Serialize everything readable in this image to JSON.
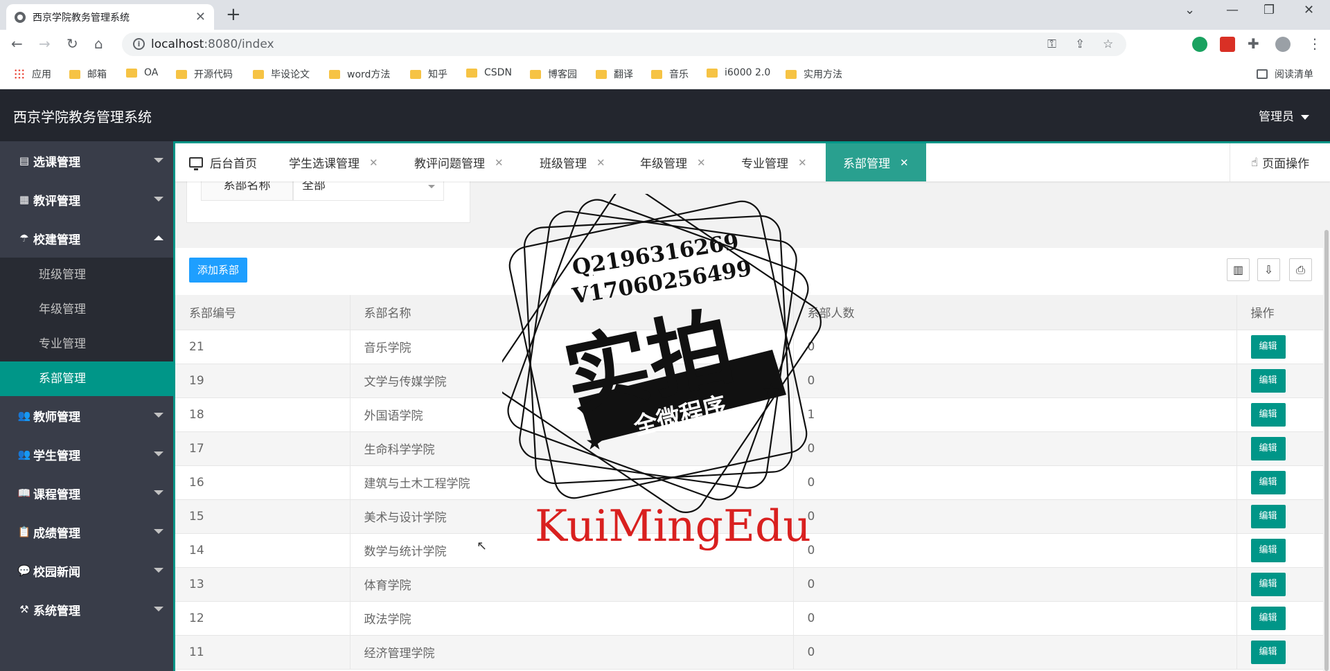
{
  "browser": {
    "tab_title": "西京学院教务管理系统",
    "url_host": "localhost",
    "url_rest": ":8080/index",
    "bookmarks": [
      "应用",
      "邮箱",
      "OA",
      "开源代码",
      "毕设论文",
      "word方法",
      "知乎",
      "CSDN",
      "博客园",
      "翻译",
      "音乐",
      "i6000 2.0",
      "实用方法"
    ],
    "reading_list": "阅读清单"
  },
  "header": {
    "logo": "西京学院教务管理系统",
    "user": "管理员"
  },
  "sidebar": {
    "items": [
      {
        "label": "选课管理",
        "icon": "document-icon"
      },
      {
        "label": "教评管理",
        "icon": "grid-icon"
      },
      {
        "label": "校建管理",
        "icon": "umbrella-icon"
      },
      {
        "label": "教师管理",
        "icon": "users-icon"
      },
      {
        "label": "学生管理",
        "icon": "users-icon"
      },
      {
        "label": "课程管理",
        "icon": "book-icon"
      },
      {
        "label": "成绩管理",
        "icon": "clipboard-icon"
      },
      {
        "label": "校园新闻",
        "icon": "chat-icon"
      },
      {
        "label": "系统管理",
        "icon": "tools-icon"
      }
    ],
    "subitems": [
      "班级管理",
      "年级管理",
      "专业管理",
      "系部管理"
    ],
    "active_sub": "系部管理"
  },
  "tabs": {
    "home": "后台首页",
    "items": [
      "学生选课管理",
      "教评问题管理",
      "班级管理",
      "年级管理",
      "专业管理",
      "系部管理"
    ],
    "page_ops": "页面操作"
  },
  "filter": {
    "label": "系部名称",
    "value": "全部"
  },
  "toolbar": {
    "add_label": "添加系部"
  },
  "table": {
    "columns": [
      "系部编号",
      "系部名称",
      "系部人数",
      "操作"
    ],
    "edit_label": "编辑",
    "rows": [
      {
        "id": "21",
        "name": "音乐学院",
        "count": "0"
      },
      {
        "id": "19",
        "name": "文学与传媒学院",
        "count": "0"
      },
      {
        "id": "18",
        "name": "外国语学院",
        "count": "1"
      },
      {
        "id": "17",
        "name": "生命科学学院",
        "count": "0"
      },
      {
        "id": "16",
        "name": "建筑与土木工程学院",
        "count": "0"
      },
      {
        "id": "15",
        "name": "美术与设计学院",
        "count": "0"
      },
      {
        "id": "14",
        "name": "数学与统计学院",
        "count": "0"
      },
      {
        "id": "13",
        "name": "体育学院",
        "count": "0"
      },
      {
        "id": "12",
        "name": "政法学院",
        "count": "0"
      },
      {
        "id": "11",
        "name": "经济管理学院",
        "count": "0"
      }
    ]
  },
  "watermark": {
    "qq": "Q2196316269",
    "wechat": "V17060256499",
    "big": "实拍",
    "ribbon": "全微程序",
    "brand": "KuiMingEdu",
    "brand_color": "#d9201f"
  },
  "colors": {
    "header_bg": "#23262e",
    "sidebar_bg": "#393d49",
    "accent": "#009688",
    "add_button": "#1e9fff"
  }
}
